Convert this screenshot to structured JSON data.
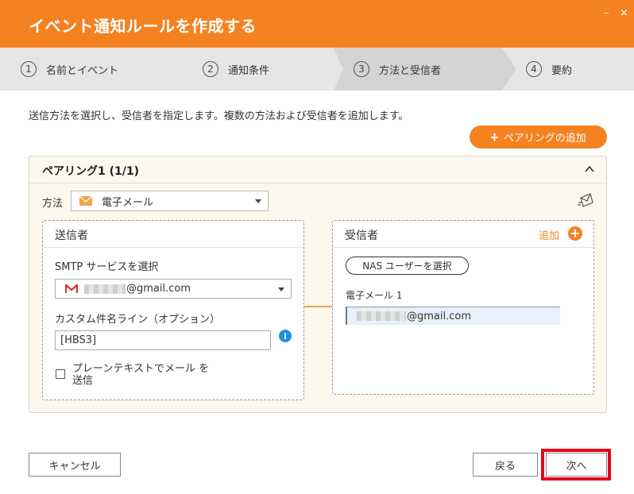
{
  "window": {
    "title": "イベント通知ルールを作成する",
    "minimize": "–",
    "close": "×"
  },
  "steps": [
    {
      "num": "1",
      "label": "名前とイベント"
    },
    {
      "num": "2",
      "label": "通知条件"
    },
    {
      "num": "3",
      "label": "方法と受信者",
      "active": true
    },
    {
      "num": "4",
      "label": "要約"
    }
  ],
  "instruction": "送信方法を選択し、受信者を指定します。複数の方法および受信者を追加します。",
  "add_pairing": {
    "plus": "+",
    "label": "ペアリングの追加"
  },
  "pairing": {
    "title": "ペアリング1 (1/1)",
    "method_label": "方法",
    "method_value": "電子メール",
    "sender": {
      "title": "送信者",
      "smtp_label": "SMTP サービスを選択",
      "smtp_value": "@gmail.com",
      "subject_label": "カスタム件名ライン（オプション）",
      "subject_value": "[HBS3]",
      "info": "i",
      "plain_text_label": "プレーンテキストでメール を送信"
    },
    "receiver": {
      "title": "受信者",
      "add_label": "追加",
      "add_plus": "+",
      "nas_button": "NAS ユーザーを選択",
      "email1_label": "電子メール 1",
      "email1_value": "@gmail.com"
    }
  },
  "buttons": {
    "cancel": "キャンセル",
    "back": "戻る",
    "next": "次へ"
  },
  "colors": {
    "accent": "#f58220",
    "highlight": "#e8001c",
    "info": "#1e90e0"
  }
}
